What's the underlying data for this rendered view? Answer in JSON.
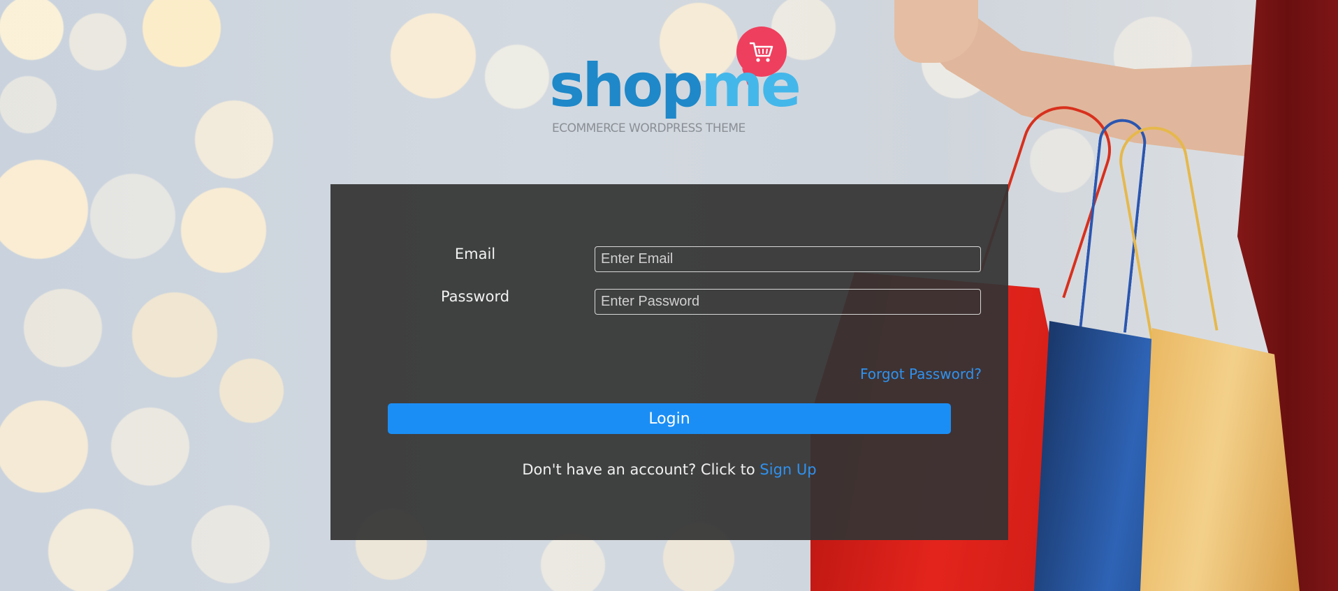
{
  "logo": {
    "brand_part1": "shop",
    "brand_part2": "me",
    "tagline": "ECOMMERCE WORDPRESS THEME",
    "icon": "cart-icon",
    "colors": {
      "shop": "#1e88c9",
      "me": "#44b7ea",
      "bubble": "#ef3f5e"
    }
  },
  "form": {
    "email_label": "Email",
    "email_placeholder": "Enter Email",
    "email_value": "",
    "password_label": "Password",
    "password_placeholder": "Enter Password",
    "password_value": "",
    "forgot_label": "Forgot Password?",
    "login_label": "Login",
    "signup_prompt": "Don't have an account? Click to",
    "signup_link": "Sign Up"
  },
  "colors": {
    "accent": "#1b8ef5",
    "link": "#2f92ef",
    "panel": "#343434"
  }
}
